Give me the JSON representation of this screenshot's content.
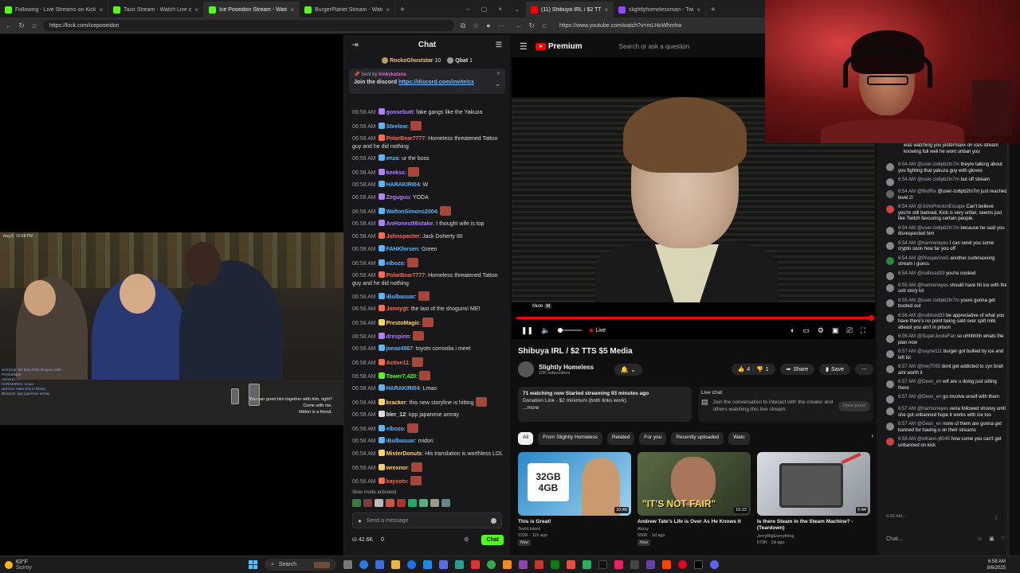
{
  "left_browser": {
    "tabs": [
      {
        "title": "Following - Live Streams on Kick",
        "color": "#53fc18"
      },
      {
        "title": "Tazo Stream - Watch Live on Kick",
        "color": "#53fc18"
      },
      {
        "title": "Ice Poseidon Stream - Watch",
        "color": "#53fc18",
        "active": true
      },
      {
        "title": "BurgerPlanet Stream - Watch",
        "color": "#53fc18"
      }
    ],
    "url": "https://kick.com/iceposeidon",
    "video": {
      "timestamp": "Aug 6, 10:58 PM",
      "caption_lines": [
        "You can greet him together with him, right?",
        "Come with me.",
        "Midori is a friend."
      ],
      "mini_chat": [
        "Jennyvgt: the last of the shoguns ME!",
        "PrestoMagic",
        "Active11: ...",
        "HARAKIRI04: Lmao",
        "wrexnor: kekw this is hitting",
        "Blossom: kpp japanese amray"
      ]
    }
  },
  "kick_chat": {
    "title": "Chat",
    "gifters": [
      {
        "name": "RockoGhoststar",
        "count": "10"
      },
      {
        "name": "Qbat",
        "count": "1"
      }
    ],
    "pinned": {
      "sent_by_label": "Sent by",
      "sender": "kinkykatana",
      "text": "Join the discord",
      "link": "https://discord.com/invite/cx"
    },
    "messages": [
      {
        "time": "06:58 AM",
        "user": "goosebutt",
        "color": "#b57dff",
        "text": ": fake gangs like the Yakuza",
        "emote": false
      },
      {
        "time": "06:58 AM",
        "user": "Steelow",
        "color": "#58b6ff",
        "text": ":",
        "emote": true
      },
      {
        "time": "06:58 AM",
        "user": "PolarBear7777",
        "color": "#ff6b4a",
        "text": ": Homeless threatened Tattoo guy and he did nothing",
        "emote": false
      },
      {
        "time": "06:58 AM",
        "user": "enza",
        "color": "#58b6ff",
        "text": ": ur the boss",
        "emote": false
      },
      {
        "time": "06:58 AM",
        "user": "keekss",
        "color": "#b57dff",
        "text": ":",
        "emote": true
      },
      {
        "time": "06:58 AM",
        "user": "HARAKIRI04",
        "color": "#58b6ff",
        "text": ": W",
        "emote": false
      },
      {
        "time": "06:58 AM",
        "user": "Zeguguu",
        "color": "#b57dff",
        "text": ": YODA",
        "emote": false
      },
      {
        "time": "06:58 AM",
        "user": "WaltonSimons2004",
        "color": "#58b6ff",
        "text": ":",
        "emote": true
      },
      {
        "time": "06:58 AM",
        "user": "AnHonestMistake",
        "color": "#b57dff",
        "text": ": I thought wife is top",
        "emote": false
      },
      {
        "time": "06:58 AM",
        "user": "Johnspecter",
        "color": "#ff6b4a",
        "text": ": Jack Doherty IIII",
        "emote": false
      },
      {
        "time": "06:58 AM",
        "user": "FAHKforsen",
        "color": "#58b6ff",
        "text": ": Green",
        "emote": false
      },
      {
        "time": "06:58 AM",
        "user": "elbozo",
        "color": "#58b6ff",
        "text": ":",
        "emote": true
      },
      {
        "time": "06:58 AM",
        "user": "PolarBear7777",
        "color": "#ff6b4a",
        "text": ": Homeless threatened Tattoo guy and he did nothing",
        "emote": false
      },
      {
        "time": "06:58 AM",
        "user": "iBulbasuar",
        "color": "#58b6ff",
        "text": ":",
        "emote": true
      },
      {
        "time": "06:58 AM",
        "user": "Jonnygt",
        "color": "#ff6b4a",
        "text": ": the last of the shoguns! ME!",
        "emote": false
      },
      {
        "time": "06:58 AM",
        "user": "PrestoMagic",
        "color": "#ffd35c",
        "text": ":",
        "emote": true
      },
      {
        "time": "06:58 AM",
        "user": "drespinn",
        "color": "#b57dff",
        "text": ":",
        "emote": true
      },
      {
        "time": "06:58 AM",
        "user": "jonaz4567",
        "color": "#58b6ff",
        "text": ": toyots corroolia i meet",
        "emote": false
      },
      {
        "time": "06:58 AM",
        "user": "Active11",
        "color": "#ff6b4a",
        "text": ":",
        "emote": true
      },
      {
        "time": "06:58 AM",
        "user": "Tower7,420",
        "color": "#53fc18",
        "text": ":",
        "emote": true
      },
      {
        "time": "06:58 AM",
        "user": "HARAKIRI04",
        "color": "#58b6ff",
        "text": ": Lmao",
        "emote": false
      },
      {
        "time": "06:58 AM",
        "user": "kracker",
        "color": "#ffd35c",
        "text": ": this new storyline is hitting",
        "emote": true
      },
      {
        "time": "06:58 AM",
        "user": "bler_12",
        "color": "#ddd",
        "text": ": kpp japanese amray",
        "emote": false
      },
      {
        "time": "06:58 AM",
        "user": "elbozo",
        "color": "#58b6ff",
        "text": ":",
        "emote": true
      },
      {
        "time": "06:58 AM",
        "user": "iBulbasuar",
        "color": "#58b6ff",
        "text": ": midori",
        "emote": false
      },
      {
        "time": "06:58 AM",
        "user": "MisterDonuts",
        "color": "#ffd35c",
        "text": ": His translation is worthless LOL",
        "emote": false
      },
      {
        "time": "06:58 AM",
        "user": "wrexnor",
        "color": "#ffd35c",
        "text": ":",
        "emote": true
      },
      {
        "time": "06:58 AM",
        "user": "kayxotv",
        "color": "#ff6b4a",
        "text": ":",
        "emote": true
      }
    ],
    "slow_mode": "Slow mode activated",
    "input_placeholder": "Send a message",
    "viewer_count": "42.6K",
    "points": "0",
    "send_label": "Chat"
  },
  "right_browser": {
    "tabs": [
      {
        "title": "(11) Shibuya IRL / $2 TTS $5 Media",
        "color": "#ff0000",
        "active": true
      },
      {
        "title": "slightlyhomelessman - Twitch",
        "color": "#9146ff"
      }
    ],
    "url": "https://www.youtube.com/watch?v=mLHoWhmhw",
    "header": {
      "brand": "Premium",
      "search_placeholder": "Search or ask a question"
    },
    "player": {
      "tooltip": "Mute",
      "tooltip_key": "M",
      "live_label": "Live"
    },
    "video_title": "Shibuya IRL / $2 TTS $5 Media",
    "channel": {
      "name": "Slightly Homeless",
      "subs": "12K subscribers"
    },
    "actions": {
      "likes": "4",
      "dislikes": "1",
      "share": "Share",
      "save": "Save"
    },
    "description": {
      "stats": "71 watching now  Started streaming 93 minutes ago",
      "line": "Donation Link - $2 minimum (both links work)",
      "more": "...more"
    },
    "live_chat": {
      "title": "Live chat",
      "text": "Join the conversation to interact with the creator and others watching this live stream.",
      "button": "Open panel"
    },
    "chips": [
      "All",
      "From Slightly Homeless",
      "Related",
      "For you",
      "Recently uploaded",
      "Watc"
    ],
    "recommendations": [
      {
        "title": "This is Great!",
        "channel": "TechLinked",
        "meta": "222K · 11h ago",
        "badge": "New",
        "duration": "10:46",
        "thumb_text": "32GB 4GB",
        "color": "#3aa0d8"
      },
      {
        "title": "Andrew Tate's Life is Over As He Knows It",
        "channel": "Atozy",
        "meta": "556K · 1d ago",
        "badge": "New",
        "duration": "15:22",
        "thumb_text": "\"IT'S NOT FAIR\"",
        "color": "#4a5a3a"
      },
      {
        "title": "Is there Steam in the Steam Machine? - (Teardown)",
        "channel": "JerryRigEverything",
        "meta": "579K · 2d ago",
        "badge": "",
        "duration": "6:44",
        "thumb_text": "",
        "color": "#b8c0c8"
      }
    ]
  },
  "twitch_chat": {
    "top_text": "was watching you jestermaxx on ices stream knowing full well he wont unban you",
    "messages": [
      {
        "time": "6:54 AM",
        "user": "@user-zo6pb2tn7m",
        "text": "theyre talking about you fighting that yakuza guy with gloves",
        "color": "#888"
      },
      {
        "time": "6:54 AM",
        "user": "@user-zo6pb2tn7m",
        "text": "but off stream",
        "color": "#888"
      },
      {
        "time": "6:54 AM",
        "user": "@BotRix",
        "text": "@user-zo6pb2tn7m just reached level 2!",
        "color": "#666"
      },
      {
        "time": "6:54 AM",
        "user": "@JohnPrestonEscape",
        "text": "Can't believe you're still banned, Kick is very unfair, seems just like Twitch favouring certain people.",
        "color": "#c44"
      },
      {
        "time": "6:54 AM",
        "user": "@user-zo6pb2tn7m",
        "text": "because he said you disrespected him",
        "color": "#888"
      },
      {
        "time": "6:54 AM",
        "user": "@harmoneyes",
        "text": "I can send you some crypto soon how far you off",
        "color": "#888"
      },
      {
        "time": "6:54 AM",
        "user": "@ProsperinoG",
        "text": "another curbmaxxing stream i guess",
        "color": "#2a8a3a"
      },
      {
        "time": "6:54 AM",
        "user": "@nullinsid33",
        "text": "you're cooked",
        "color": "#888"
      },
      {
        "time": "6:55 AM",
        "user": "@harmoneyes",
        "text": "should have hit ice with the sob story lol",
        "color": "#888"
      },
      {
        "time": "6:55 AM",
        "user": "@user-zo6pb2tn7m",
        "text": "youre gunna get booted out",
        "color": "#888"
      },
      {
        "time": "6:56 AM",
        "user": "@nullinsid33",
        "text": "be appreciative of what you have there's no point being sald over spilt milk atleast you ain't in prison",
        "color": "#888"
      },
      {
        "time": "6:56 AM",
        "user": "@SuperJoolieFan",
        "text": "so uhhhhhh whats the plan now",
        "color": "#888"
      },
      {
        "time": "6:57 AM",
        "user": "@vayne111",
        "text": "burger got bullied by ice and left lol",
        "color": "#888"
      },
      {
        "time": "6:57 AM",
        "user": "@mej7093",
        "text": "dont get addicted to zyn brah aint worth it",
        "color": "#888"
      },
      {
        "time": "6:57 AM",
        "user": "@Deon_en",
        "text": "wtf are u doing just sitting there",
        "color": "#888"
      },
      {
        "time": "6:57 AM",
        "user": "@Deon_en",
        "text": "go involve urself with them",
        "color": "#888"
      },
      {
        "time": "6:57 AM",
        "user": "@harmoneyes",
        "text": "xena followed shoovy until she got unbanned hope it works with ice too",
        "color": "#888"
      },
      {
        "time": "6:57 AM",
        "user": "@Deon_en",
        "text": "none of them are gonna get banned for having u on their streams",
        "color": "#888"
      },
      {
        "time": "6:58 AM",
        "user": "@ethann-j6045",
        "text": "how come you can't get unbanned on kick",
        "color": "#c44"
      }
    ],
    "timer": "6:58 AM...",
    "input_placeholder": "Chat..."
  },
  "taskbar": {
    "temperature": "63°F",
    "condition": "Sunny",
    "search_label": "Search",
    "time": "6:58 AM",
    "date": "8/6/2025"
  }
}
